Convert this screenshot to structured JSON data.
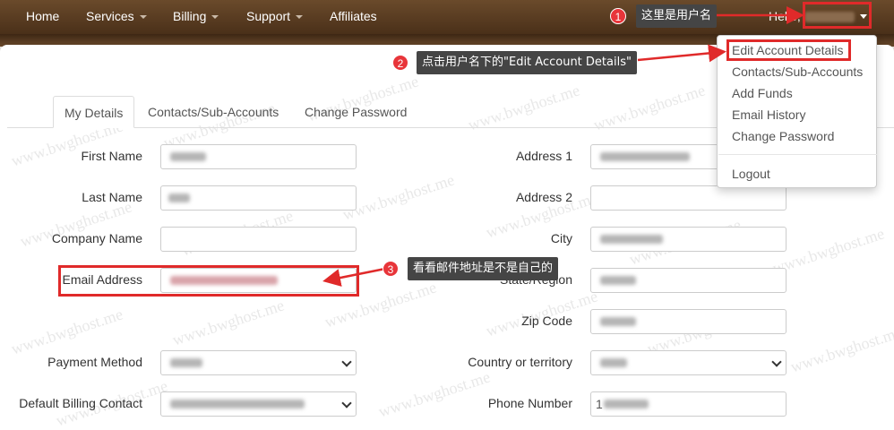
{
  "nav": {
    "items": [
      {
        "label": "Home",
        "has_caret": false
      },
      {
        "label": "Services",
        "has_caret": true
      },
      {
        "label": "Billing",
        "has_caret": true
      },
      {
        "label": "Support",
        "has_caret": true
      },
      {
        "label": "Affiliates",
        "has_caret": false
      }
    ],
    "greeting": "Hello,"
  },
  "dropdown": {
    "items": [
      "Edit Account Details",
      "Contacts/Sub-Accounts",
      "Add Funds",
      "Email History",
      "Change Password"
    ],
    "logout": "Logout"
  },
  "tabs": [
    "My Details",
    "Contacts/Sub-Accounts",
    "Change Password"
  ],
  "form": {
    "left": {
      "first_name": "First Name",
      "last_name": "Last Name",
      "company_name": "Company Name",
      "email": "Email Address",
      "payment_method": "Payment Method",
      "billing_contact": "Default Billing Contact"
    },
    "right": {
      "address1": "Address 1",
      "address2": "Address 2",
      "city": "City",
      "state": "State/Region",
      "zip": "Zip Code",
      "country": "Country or territory",
      "phone": "Phone Number",
      "phone_value_prefix": "1"
    }
  },
  "annotations": {
    "step1": {
      "num": "1",
      "text": "这里是用户名"
    },
    "step2": {
      "num": "2",
      "text": "点击用户名下的\"Edit Account Details\""
    },
    "step3": {
      "num": "3",
      "text": "看看邮件地址是不是自己的"
    }
  },
  "watermark": "www.bwghost.me",
  "colors": {
    "annotation_red": "#e02a2a",
    "nav_brown": "#5a3c22"
  }
}
